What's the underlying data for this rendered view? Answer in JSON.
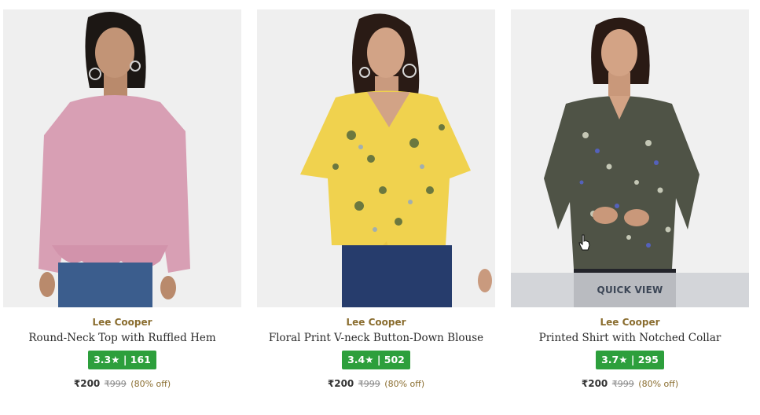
{
  "products": [
    {
      "brand": "Lee Cooper",
      "title": "Round-Neck Top with Ruffled Hem",
      "rating": "3.3",
      "star": "★",
      "sep": "|",
      "reviews": "161",
      "price": "₹200",
      "mrp": "₹999",
      "discount": "(80% off)",
      "top_color": "#d89fb4",
      "show_quick_view": false
    },
    {
      "brand": "Lee Cooper",
      "title": "Floral Print V-neck Button-Down Blouse",
      "rating": "3.4",
      "star": "★",
      "sep": "|",
      "reviews": "502",
      "price": "₹200",
      "mrp": "₹999",
      "discount": "(80% off)",
      "top_color": "#f0d24e",
      "show_quick_view": false
    },
    {
      "brand": "Lee Cooper",
      "title": "Printed Shirt with Notched Collar",
      "rating": "3.7",
      "star": "★",
      "sep": "|",
      "reviews": "295",
      "price": "₹200",
      "mrp": "₹999",
      "discount": "(80% off)",
      "top_color": "#4f5346",
      "show_quick_view": true
    }
  ],
  "quick_view_label": "QUICK VIEW",
  "colors": {
    "rating_green": "#2d9f3c",
    "brand_gold": "#8a6d2f",
    "photo_bg": "#eeeeef"
  }
}
